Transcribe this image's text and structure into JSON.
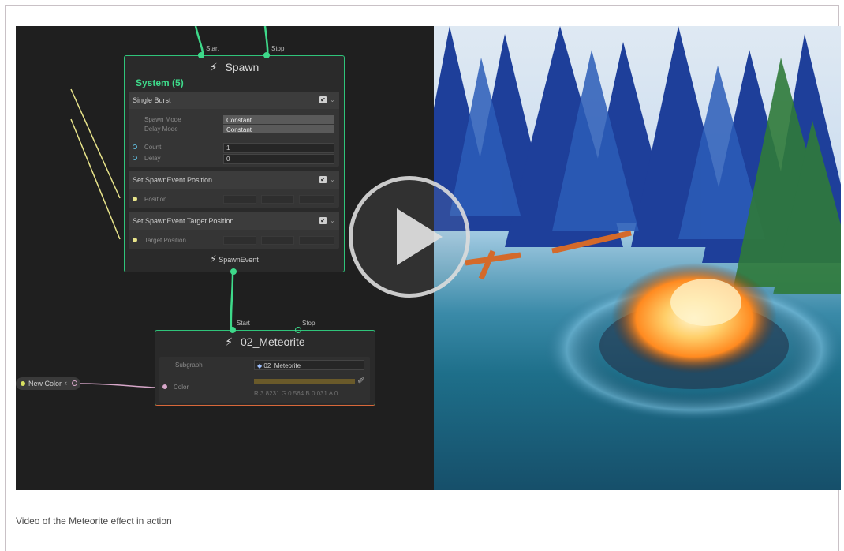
{
  "caption": "Video of the Meteorite effect in action",
  "spawn_node": {
    "title": "Spawn",
    "port_start": "Start",
    "port_stop": "Stop",
    "system_label": "System (5)",
    "single_burst": {
      "header": "Single Burst",
      "spawn_mode_label": "Spawn Mode",
      "spawn_mode_value": "Constant",
      "delay_mode_label": "Delay Mode",
      "delay_mode_value": "Constant",
      "count_label": "Count",
      "count_value": "1",
      "delay_label": "Delay",
      "delay_value": "0"
    },
    "set_position": {
      "header": "Set SpawnEvent Position",
      "row_label": "Position"
    },
    "set_target_position": {
      "header": "Set SpawnEvent Target Position",
      "row_label": "Target Position"
    },
    "output_label": "SpawnEvent"
  },
  "meteorite_node": {
    "title": "02_Meteorite",
    "port_start": "Start",
    "port_stop": "Stop",
    "subgraph_label": "Subgraph",
    "subgraph_value": "02_Meteorite",
    "color_label": "Color",
    "color_readout": "R 3.8231  G 0.564  B 0.031  A 0"
  },
  "property_node": {
    "label": "New Color"
  },
  "colors": {
    "node_border": "#2fc47a",
    "meteorite_border": "#d8683a",
    "wire_yellow": "#e8e48a",
    "wire_pink": "#d6a6c8",
    "wire_green": "#3ed98a",
    "system_text": "#3ed98a"
  },
  "icons": [
    "lightning-icon",
    "play-icon",
    "checkbox-icon",
    "chevron-down-icon",
    "eyedropper-icon",
    "target-icon"
  ]
}
